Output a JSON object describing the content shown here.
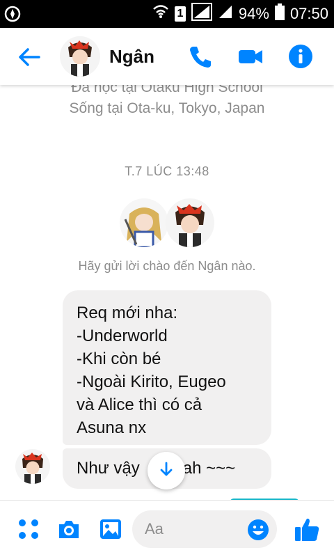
{
  "status_bar": {
    "battery": "94%",
    "time": "07:50",
    "sim_label": "1"
  },
  "header": {
    "contact_name": "Ngân",
    "accent": "#0084ff"
  },
  "conversation": {
    "profile_line1": "Đã học tại Otaku High School",
    "profile_line2": "Sống tại Ota-ku, Tokyo, Japan",
    "timestamp": "T.7 LÚC 13:48",
    "greeting": "Hãy gửi lời chào đến Ngân nào.",
    "messages": [
      {
        "lines": [
          "Req mới nha:",
          "-Underworld",
          "-Khi còn bé",
          "-Ngoài Kirito, Eugeo",
          "và Alice thì có cả",
          "Asuna nx"
        ]
      },
      {
        "text_before": "Như vậy",
        "text_after": "ah ~~~"
      }
    ]
  },
  "composer": {
    "placeholder": "Aa"
  },
  "icons": [
    "back-arrow-icon",
    "phone-icon",
    "video-camera-icon",
    "info-icon",
    "more-dots-icon",
    "camera-icon",
    "gallery-icon",
    "emoji-icon",
    "thumbs-up-icon",
    "arrow-down-icon"
  ]
}
